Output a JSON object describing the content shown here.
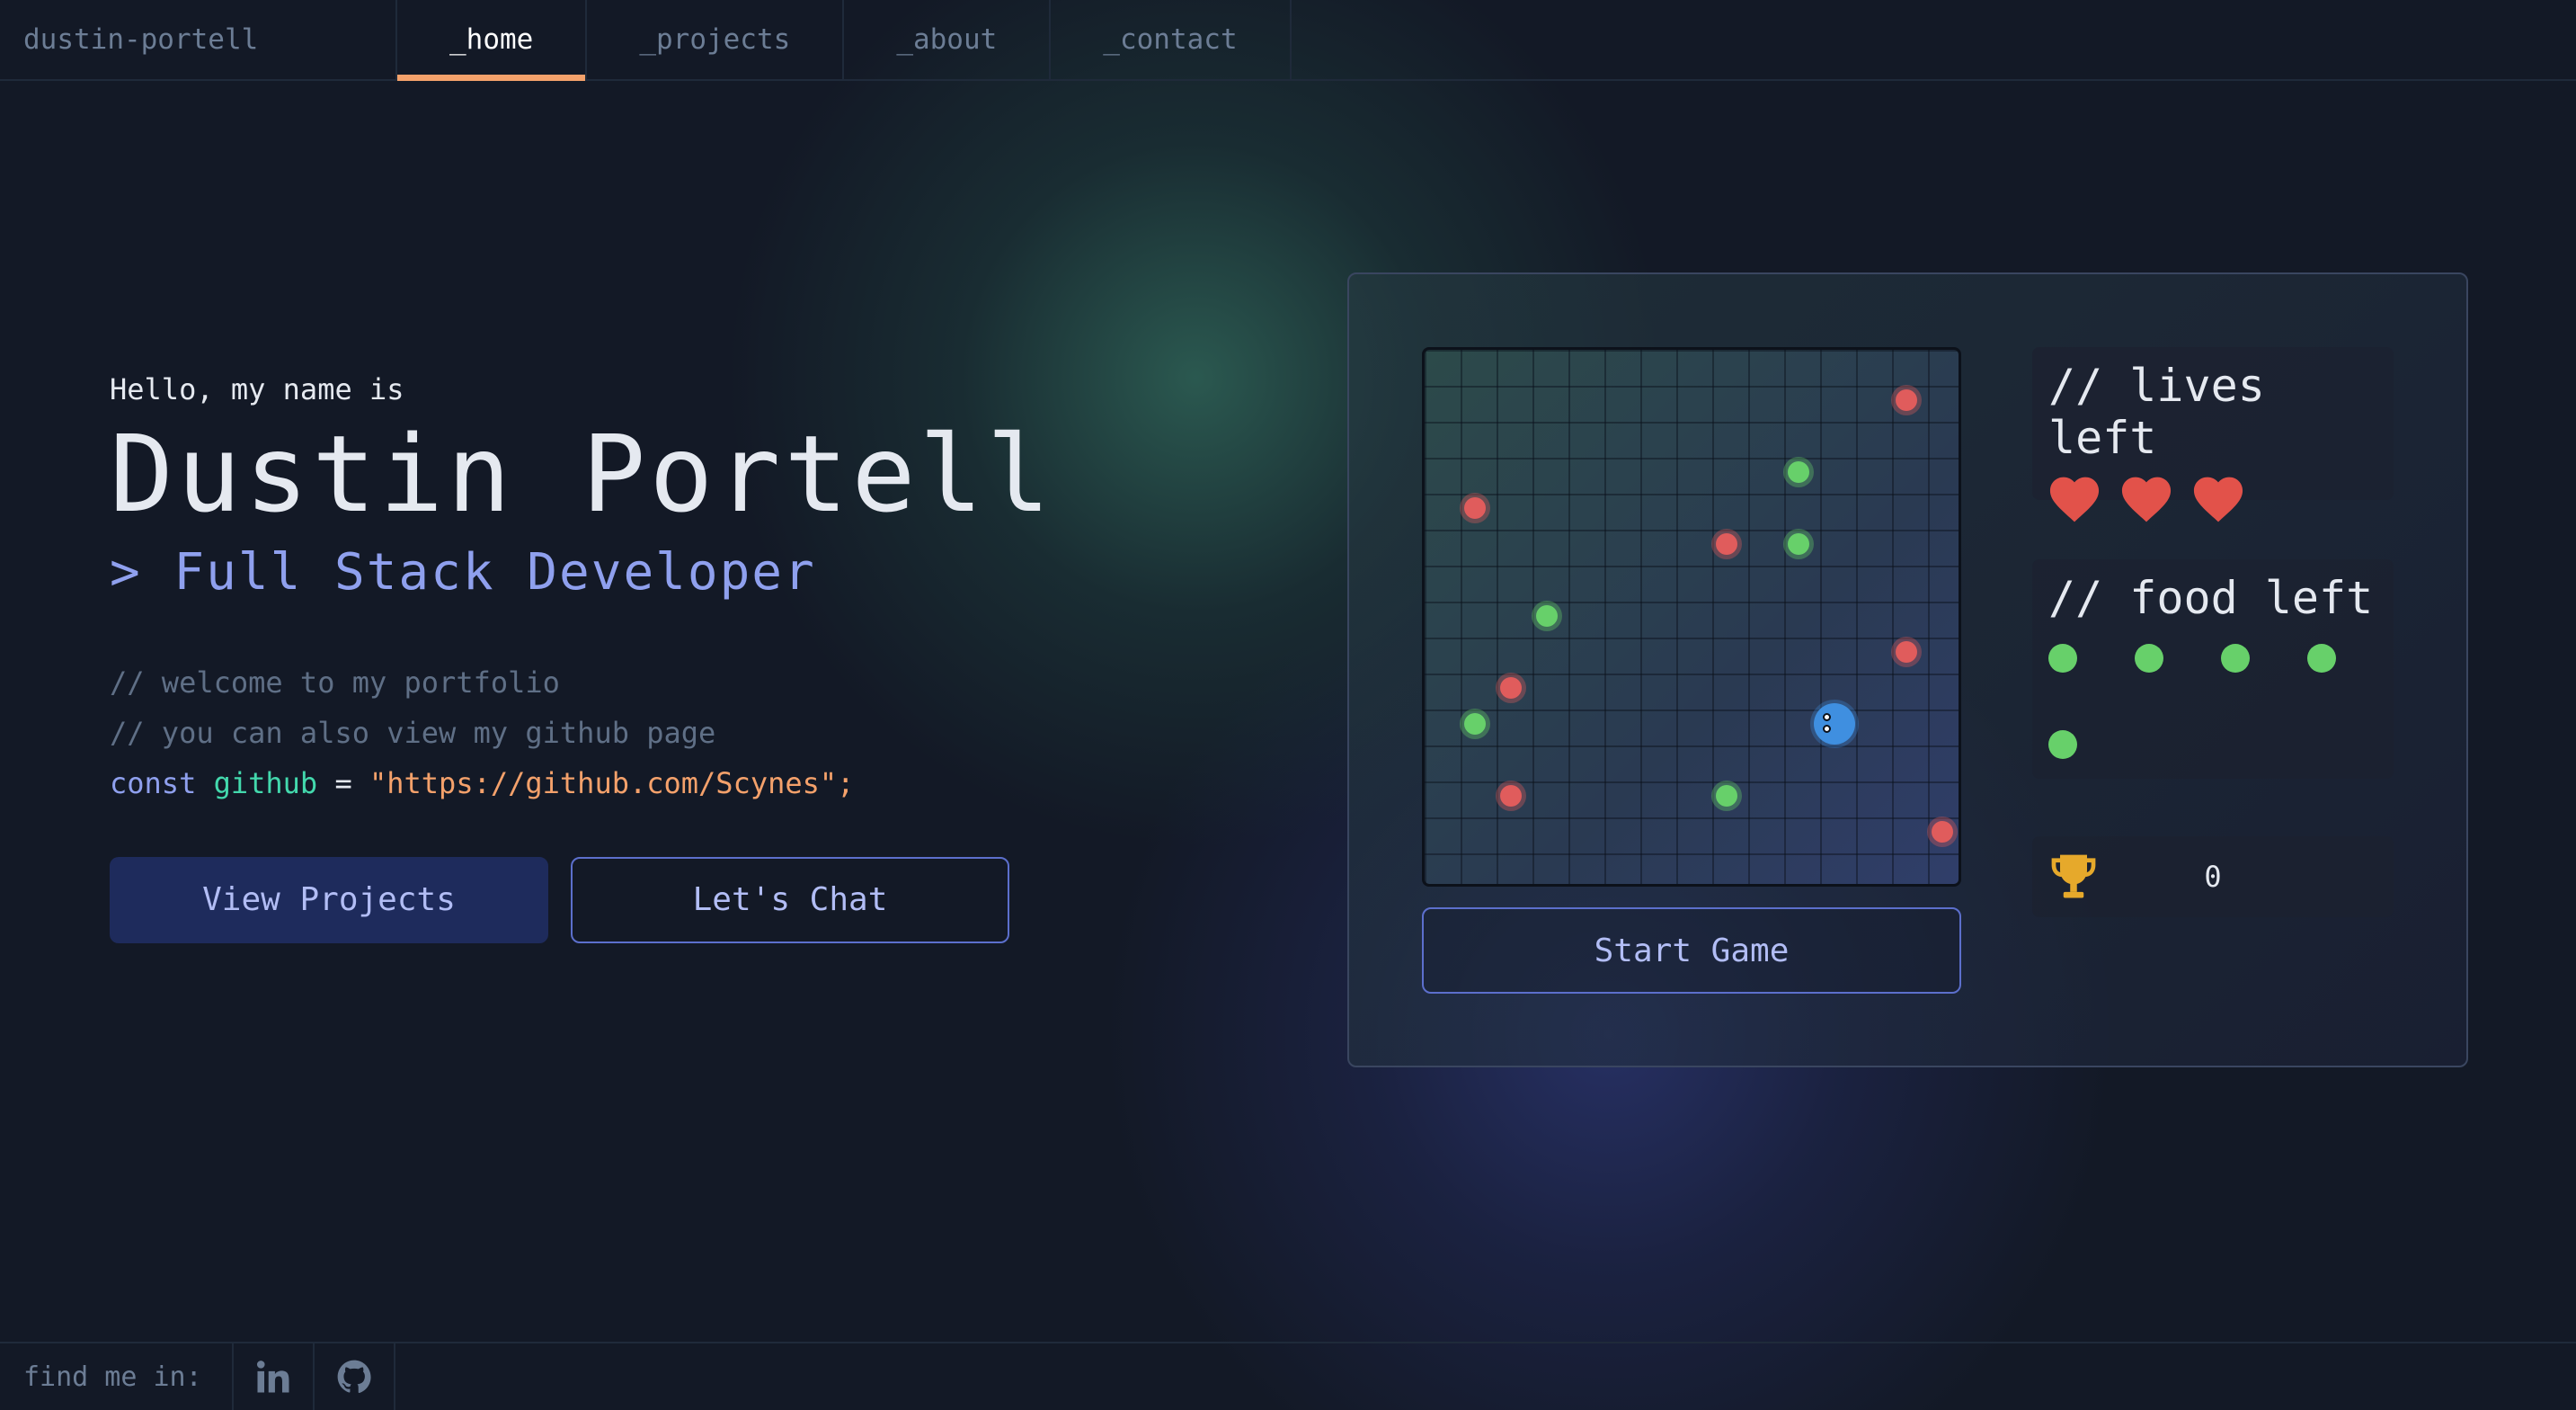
{
  "nav": {
    "brand": "dustin-portell",
    "tabs": [
      {
        "label": "_home",
        "active": true
      },
      {
        "label": "_projects",
        "active": false
      },
      {
        "label": "_about",
        "active": false
      },
      {
        "label": "_contact",
        "active": false
      }
    ],
    "active_color": "#f4a16b"
  },
  "hero": {
    "greeting": "Hello, my name is",
    "name": "Dustin Portell",
    "role": "> Full Stack Developer",
    "comment_1": "// welcome to my portfolio",
    "comment_2": "// you can also view my github page",
    "code": {
      "keyword": "const",
      "variable": "github",
      "operator": "=",
      "value": "\"https://github.com/Scynes\";"
    },
    "buttons": {
      "primary": "View Projects",
      "secondary": "Let's Chat"
    }
  },
  "game": {
    "start_label": "Start Game",
    "lives_title": "// lives left",
    "lives_count": 3,
    "food_title": "// food left",
    "food_count": 5,
    "score": "0",
    "icons": {
      "life": "heart-icon",
      "score": "trophy-icon"
    },
    "colors": {
      "enemy": "#e05c5c",
      "food": "#67d06a",
      "snake": "#3f8fe0",
      "heart": "#e2524a",
      "trophy": "#e6a92b"
    }
  },
  "footer": {
    "label": "find me in:",
    "socials": [
      "linkedin-icon",
      "github-icon"
    ]
  }
}
